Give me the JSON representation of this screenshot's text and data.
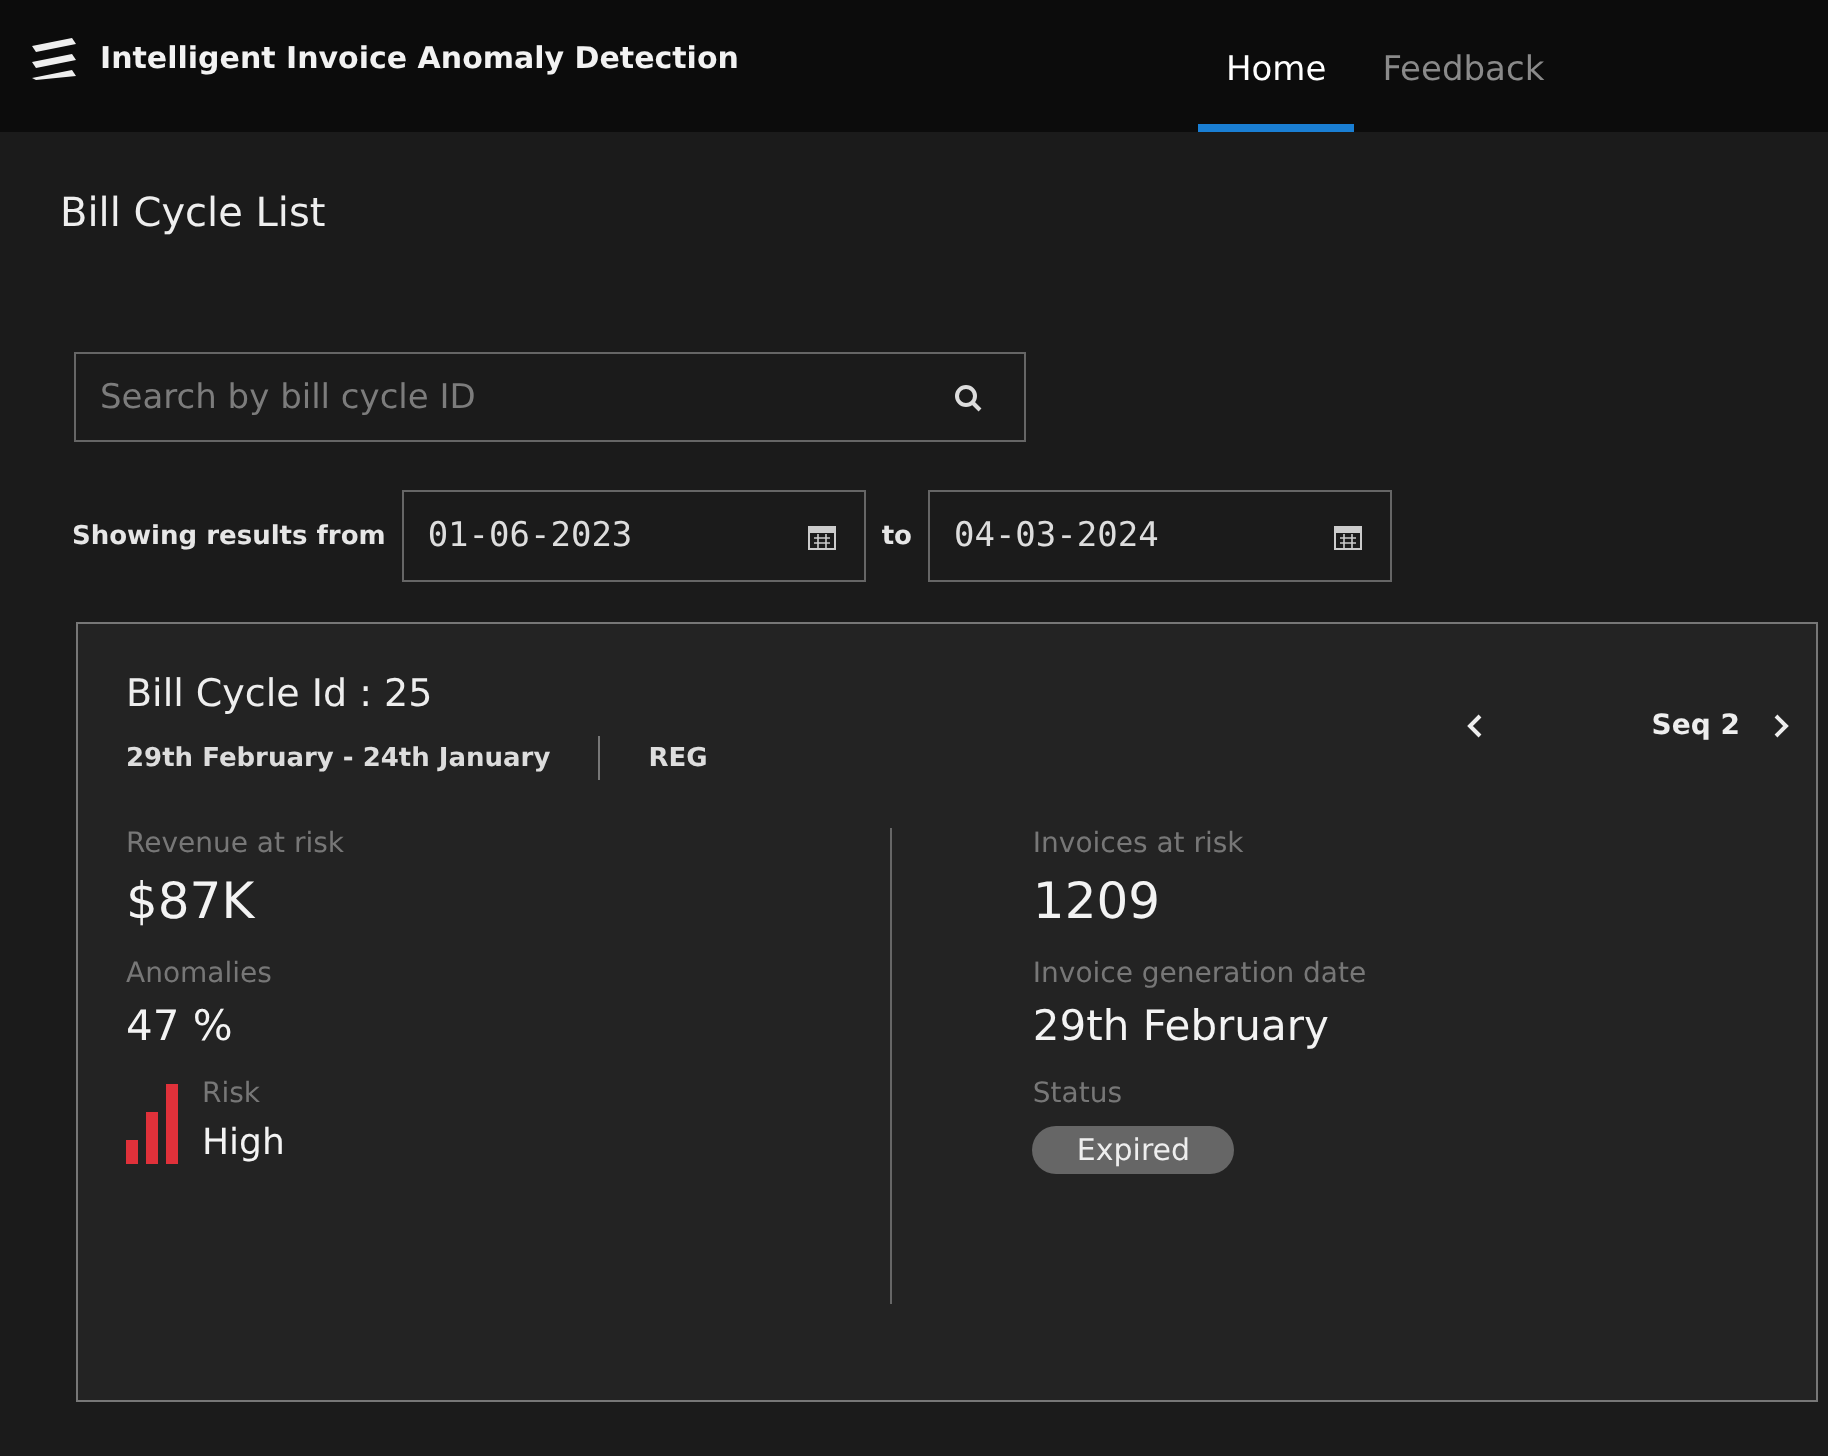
{
  "app": {
    "title": "Intelligent Invoice Anomaly Detection"
  },
  "tabs": [
    {
      "label": "Home",
      "selected": true
    },
    {
      "label": "Feedback",
      "selected": false
    }
  ],
  "page_title": "Bill Cycle List",
  "search": {
    "placeholder": "Search by bill cycle ID"
  },
  "date_range": {
    "label": "Showing results from",
    "from": "01-06-2023",
    "separator": "to",
    "to": "04-03-2024"
  },
  "card": {
    "title": "Bill Cycle Id : 25",
    "period": "29th February - 24th January",
    "type": "REG",
    "sequence": "Seq 2",
    "left": [
      {
        "label": "Revenue at risk",
        "value": "$87K"
      },
      {
        "label": "Anomalies",
        "value": "47 %"
      }
    ],
    "risk": {
      "label": "Risk",
      "value": "High"
    },
    "right": [
      {
        "label": "Invoices at risk",
        "value": "1209"
      },
      {
        "label": "Invoice generation date",
        "value": "29th February"
      }
    ],
    "status": {
      "label": "Status",
      "value": "Expired"
    }
  }
}
